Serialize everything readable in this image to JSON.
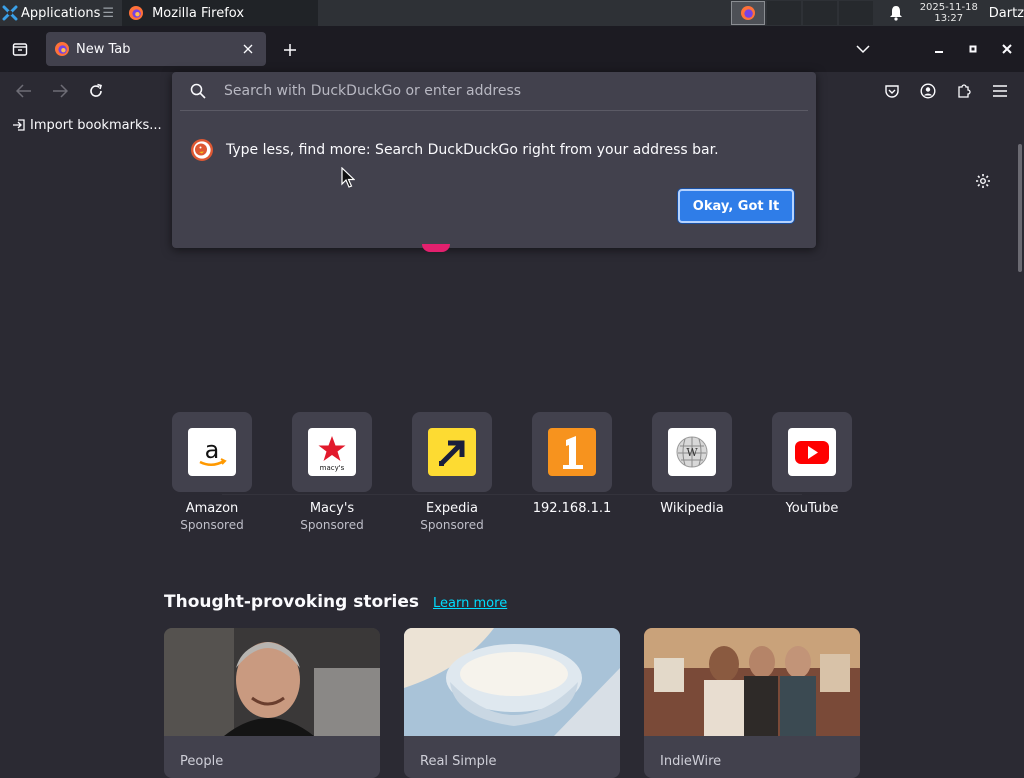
{
  "taskbar": {
    "apps_label": "Applications",
    "window_title": "Mozilla Firefox",
    "clock_date": "2025-11-18",
    "clock_time": "13:27",
    "user": "Dartz"
  },
  "tabs": [
    {
      "title": "New Tab"
    }
  ],
  "bookmarks": {
    "import_label": "Import bookmarks..."
  },
  "address_popup": {
    "placeholder": "Search with DuckDuckGo or enter address",
    "tip_text": "Type less, find more: Search DuckDuckGo right from your address bar.",
    "confirm_label": "Okay, Got It"
  },
  "shortcuts": [
    {
      "name": "Amazon",
      "sponsored": "Sponsored",
      "icon": "amazon-logo"
    },
    {
      "name": "Macy's",
      "sponsored": "Sponsored",
      "icon": "macys-logo"
    },
    {
      "name": "Expedia",
      "sponsored": "Sponsored",
      "icon": "expedia-logo"
    },
    {
      "name": "192.168.1.1",
      "sponsored": "",
      "icon": "number-one-logo"
    },
    {
      "name": "Wikipedia",
      "sponsored": "",
      "icon": "wikipedia-logo"
    },
    {
      "name": "YouTube",
      "sponsored": "",
      "icon": "youtube-logo"
    }
  ],
  "stories": {
    "heading": "Thought-provoking stories",
    "learn_more": "Learn more",
    "cards": [
      {
        "source": "People"
      },
      {
        "source": "Real Simple"
      },
      {
        "source": "IndieWire"
      }
    ]
  },
  "colors": {
    "page_bg": "#2b2a33",
    "accent_button": "#2f7de8",
    "link": "#00ddff"
  }
}
